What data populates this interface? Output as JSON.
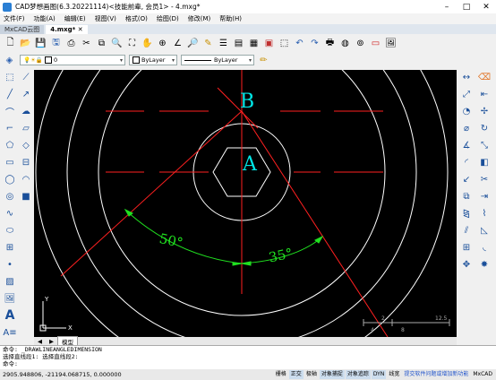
{
  "window": {
    "title": "CAD梦想画图(6.3.20221114)<技能前辈, 会员1> - 4.mxg*",
    "controls": [
      "–",
      "□",
      "✕"
    ]
  },
  "menu": [
    "文件(F)",
    "功能(A)",
    "编辑(E)",
    "视图(V)",
    "格式(O)",
    "绘图(D)",
    "修改(M)",
    "帮助(H)"
  ],
  "tabs": {
    "inactive": "MxCAD云图",
    "active": "4.mxg*"
  },
  "toolbar": [
    "new-icon",
    "open-icon",
    "save-icon",
    "save-as-icon",
    "print-preview-icon",
    "cut-icon",
    "copy-icon",
    "zoom-window-icon",
    "zoom-extents-icon",
    "pan-icon",
    "zoom-icon",
    "measure-icon",
    "find-icon",
    "match-properties-icon",
    "properties-icon",
    "layer-icon",
    "block-icon",
    "color-icon",
    "select-icon",
    "undo-icon",
    "redo-icon",
    "plot-icon",
    "globe-icon",
    "web-icon",
    "pdf-icon",
    "image-icon"
  ],
  "properties_bar": {
    "layer_value": "0",
    "color_value": "ByLayer",
    "linetype_value": "ByLayer"
  },
  "drawing": {
    "label_a": "A",
    "label_b": "B",
    "angle_1": "50°",
    "angle_2": "35°",
    "scale_labels": [
      "2",
      "12.5",
      "4",
      "8"
    ],
    "axis_x": "X",
    "axis_y": "Y",
    "colors": {
      "background": "#000000",
      "circles": "#ffffff",
      "centerlines": "#ff2020",
      "labels": "#00e5e5",
      "dimensions": "#20e020"
    }
  },
  "model_tabs": [
    "◀",
    "▶",
    "模型"
  ],
  "command_lines": [
    "命令: _DRAWLINEANGLEDIMENSION",
    "选择直线段1: 选择直线段2:",
    "命令:"
  ],
  "status": {
    "coords": "2905.948806, -21194.068715, 0.000000",
    "buttons": [
      "栅格",
      "正交",
      "极轴",
      "对象捕捉",
      "对象追踪",
      "DYN",
      "线宽",
      "提交软件问题或增加新功能",
      "MxCAD"
    ]
  }
}
